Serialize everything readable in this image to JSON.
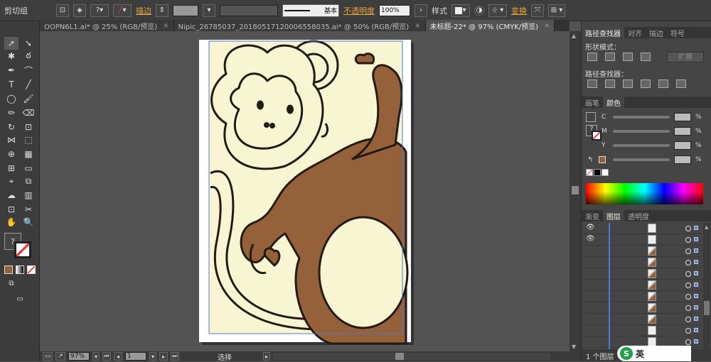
{
  "control_bar": {
    "group_label": "剪切组",
    "stroke_label": "描边",
    "stroke_style_label": "基本",
    "opacity_label": "不透明度",
    "opacity_value": "100%",
    "style_label": "样式",
    "transform_label": "变换",
    "question": "?"
  },
  "tabs": [
    {
      "label": "OOPN6L1.ai* @ 25% (RGB/预览)",
      "active": false
    },
    {
      "label": "Nipic_26785037_20180517120006558035.ai* @ 50% (RGB/预览)",
      "active": false
    },
    {
      "label": "未标题-22* @ 97% (CMYK/预览)",
      "active": true
    }
  ],
  "tab_close": "×",
  "status_bar": {
    "zoom": "97%",
    "artboard": "1",
    "tool": "选择"
  },
  "pathfinder_panel": {
    "tabs": [
      "路径查找器",
      "对齐",
      "描边",
      "符号"
    ],
    "shape_modes_label": "形状模式：",
    "expand_label": "扩展",
    "pathfinders_label": "路径查找器："
  },
  "color_panel": {
    "tabs": [
      "画笔",
      "颜色"
    ],
    "channels": [
      "C",
      "M",
      "Y",
      "K"
    ],
    "percent": "%",
    "question": "?",
    "spectrum_start": "#ff0000",
    "brown": "#95613a"
  },
  "layers_panel": {
    "tabs": [
      "渐变",
      "图层",
      "透明度"
    ],
    "footer": "1 个图层",
    "rows": 12
  },
  "ime": {
    "label": "英"
  },
  "colors": {
    "artboard_bg": "#f7f5d2",
    "monkey_brown": "#95613a",
    "outline": "#231a14"
  }
}
